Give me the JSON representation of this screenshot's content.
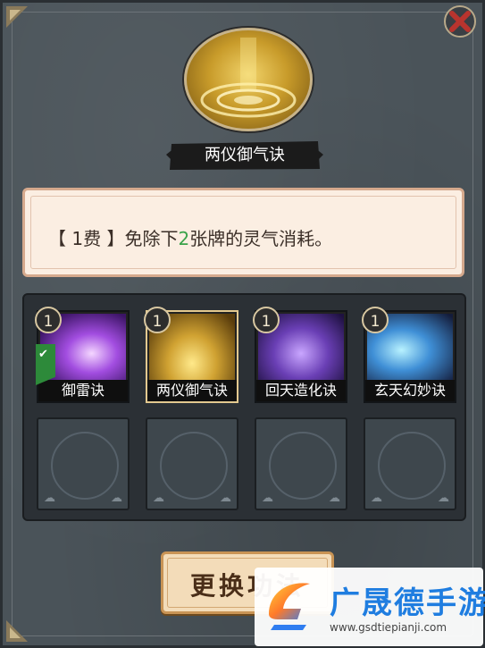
{
  "skill": {
    "name": "两仪御气诀",
    "cost_tag": "【 1费 】",
    "desc_before": "免除下",
    "desc_number": "2",
    "desc_after": "张牌的灵气消耗。"
  },
  "cards": [
    {
      "name": "御雷诀",
      "cost": "1",
      "selected_check": true
    },
    {
      "name": "两仪御气诀",
      "cost": "1",
      "selected_check": false
    },
    {
      "name": "回天造化诀",
      "cost": "1",
      "selected_check": false
    },
    {
      "name": "玄天幻妙诀",
      "cost": "1",
      "selected_check": false
    }
  ],
  "empty_slots": 4,
  "action_button": {
    "label": "更换功法"
  },
  "watermark": {
    "name": "广晟德手游",
    "url": "www.gsdtiepianji.com"
  },
  "colors": {
    "accent_green": "#3aa34a",
    "button_bg": "#f3dcb9",
    "panel": "#4a5359"
  }
}
